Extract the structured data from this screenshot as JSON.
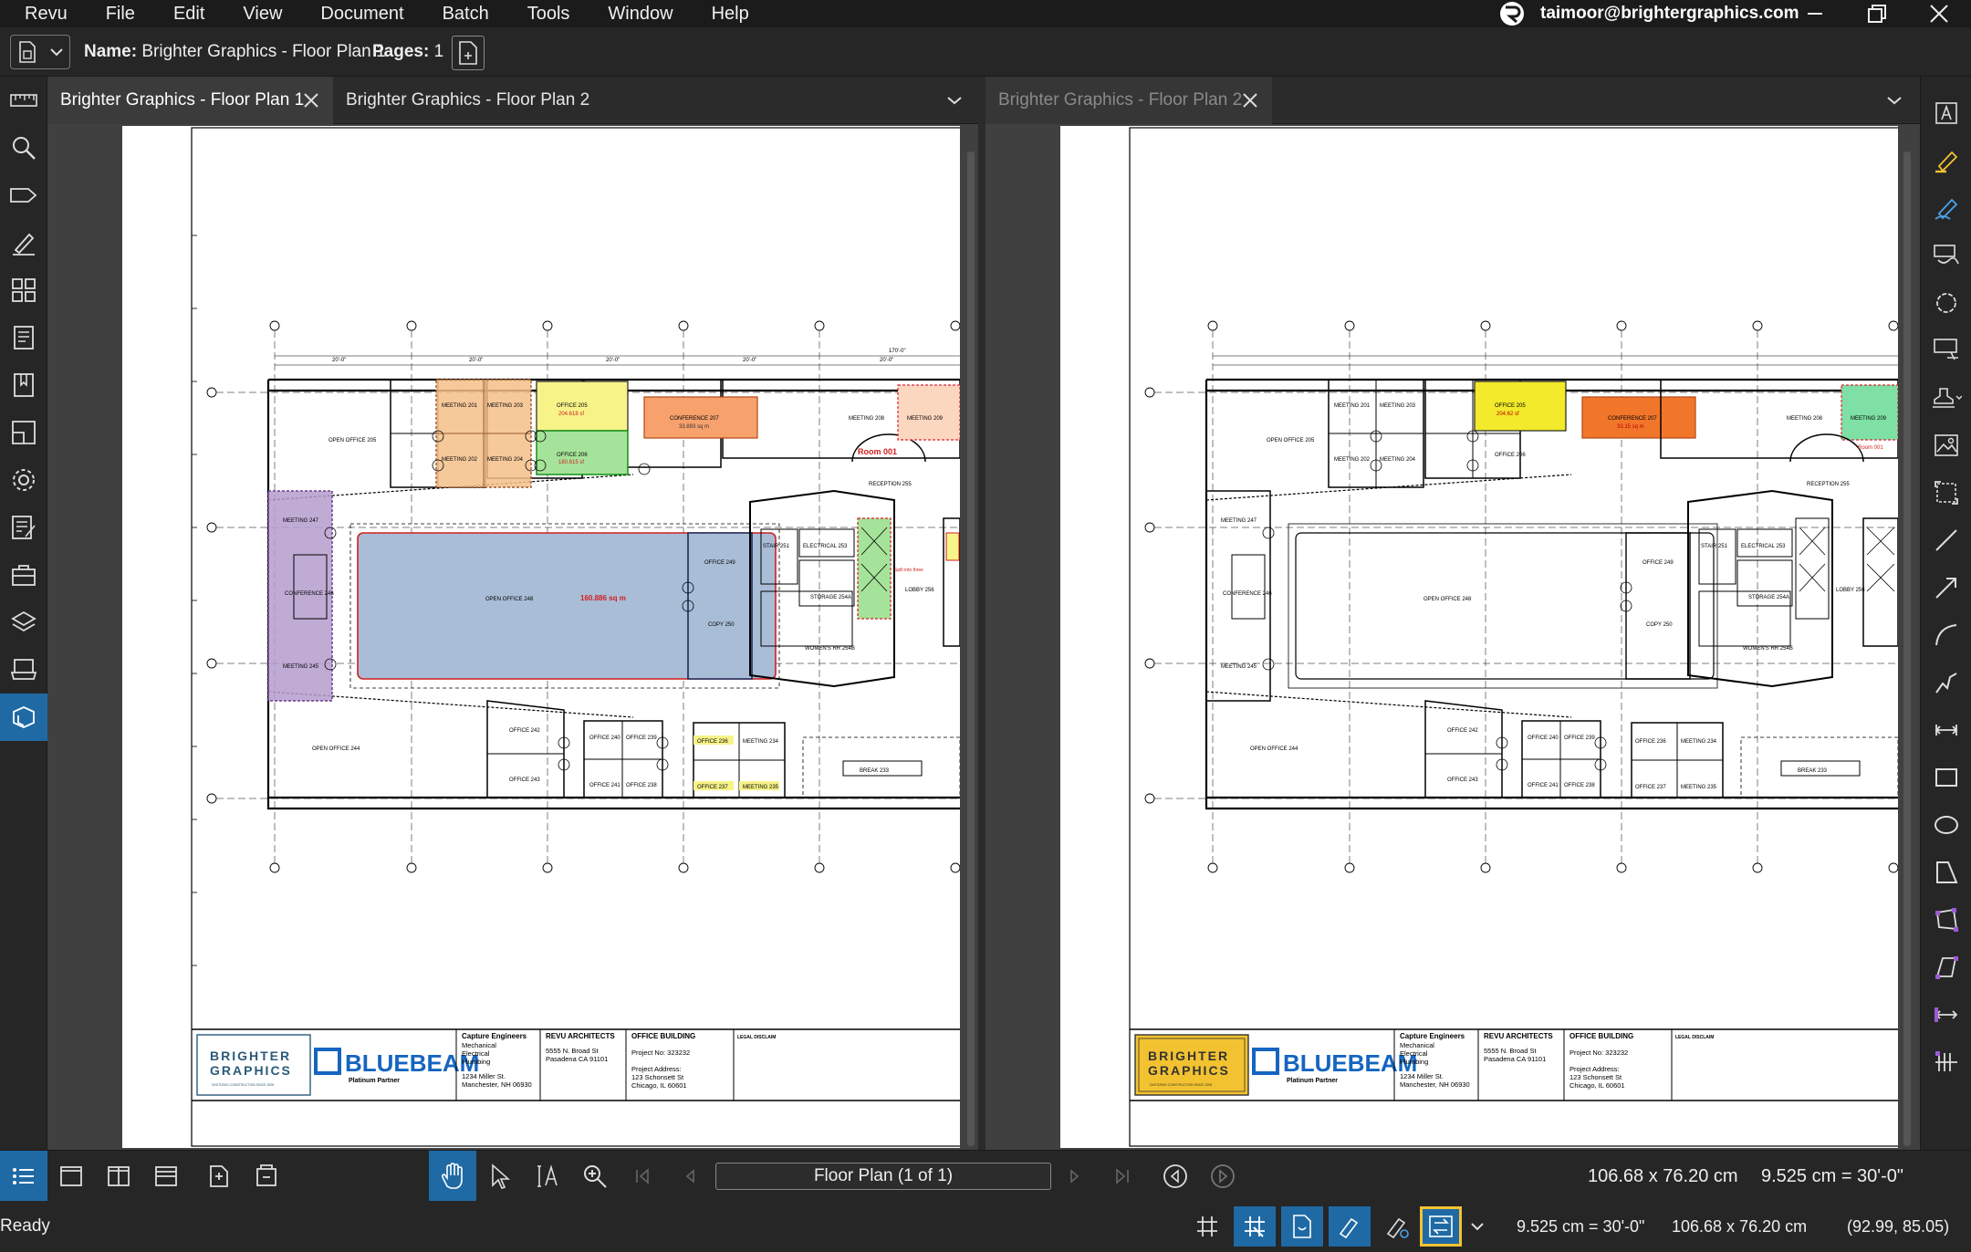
{
  "menu": [
    "Revu",
    "File",
    "Edit",
    "View",
    "Document",
    "Batch",
    "Tools",
    "Window",
    "Help"
  ],
  "user": {
    "email": "taimoor@brightergraphics.com"
  },
  "properties": {
    "name_label": "Name:",
    "name_value": "Brighter Graphics - Floor Plan 1",
    "pages_label": "Pages:",
    "pages_value": "1"
  },
  "left_tabs": [
    {
      "label": "Brighter Graphics - Floor Plan 1",
      "active": true
    },
    {
      "label": "Brighter Graphics - Floor Plan 2",
      "active": false
    }
  ],
  "right_tabs": [
    {
      "label": "Brighter Graphics - Floor Plan 2",
      "active": false
    }
  ],
  "left_toolbar_icons": [
    "measure-icon",
    "search-icon",
    "tag-icon",
    "markup-pen-icon",
    "thumbnails-icon",
    "bookmarks-icon",
    "sets-icon",
    "compare-icon",
    "settings-icon",
    "forms-icon",
    "toolchest-icon",
    "layers-icon",
    "studio-icon",
    "spaces-icon"
  ],
  "right_toolbar_icons": [
    "text-box-icon",
    "highlighter-icon",
    "pen-icon",
    "callout-icon",
    "cloud-icon",
    "note-icon",
    "stamp-icon",
    "image-icon",
    "snapshot-icon",
    "line-icon",
    "arrow-icon",
    "arc-icon",
    "polyline-icon",
    "dimension-icon",
    "rectangle-icon",
    "ellipse-icon",
    "polygon-icon",
    "area-measure-icon",
    "volume-icon",
    "length-measure-icon",
    "count-measure-icon"
  ],
  "floorplan": {
    "rooms": {
      "open_office_205": "OPEN OFFICE 205",
      "meeting_201": "MEETING 201",
      "meeting_203": "MEETING 203",
      "meeting_202": "MEETING 202",
      "meeting_204": "MEETING 204",
      "office_205": "OFFICE 205",
      "office_206": "OFFICE 206",
      "conference_207": "CONFERENCE 207",
      "meeting_208": "MEETING 208",
      "meeting_209": "MEETING 209",
      "reception": "RECEPTION 255",
      "meeting_247": "MEETING 247",
      "conference_246": "CONFERENCE 246",
      "meeting_245": "MEETING 245",
      "open_office_248": "OPEN OFFICE 248",
      "office_249": "OFFICE 249",
      "copy_250": "COPY 250",
      "stair": "STAIR 251",
      "electrical": "ELECTRICAL 253",
      "storage": "STORAGE 254A",
      "womens_rr": "WOMEN'S RR 254B",
      "lobby": "LOBBY 256",
      "open_office_244": "OPEN OFFICE 244",
      "office_242": "OFFICE 242",
      "office_243": "OFFICE 243",
      "office_240": "OFFICE 240",
      "office_239": "OFFICE 239",
      "office_241": "OFFICE 241",
      "office_238": "OFFICE 238",
      "office_236": "OFFICE 236",
      "meeting_234": "MEETING 234",
      "office_237": "OFFICE 237",
      "meeting_235": "MEETING 235",
      "break_233": "BREAK 233"
    },
    "markups": {
      "office_205_area": "204.618 sf",
      "office_206_area": "180.615 sf",
      "conference_area": "33.893 sq m",
      "room_001": "Room 001",
      "open_office_area": "160.886 sq m",
      "split_note": "Split into three",
      "right_office_205_area": "204.62 sf",
      "right_conference_area": "33.15 sq m",
      "right_room_001": "Room 001"
    },
    "titleblock": {
      "brighter_line1": "BRIGHTER",
      "brighter_line2": "GRAPHICS",
      "brighter_tagline": "DIGITIZING CONSTRUCTION SINCE 2005",
      "bluebeam": "BLUEBEAM",
      "bluebeam_sub": "Platinum Partner",
      "engineers_title": "Capture Engineers",
      "engineers_lines": [
        "Mechanical",
        "Electrical",
        "Plumbing"
      ],
      "engineers_addr1": "1234 Miller St.",
      "engineers_addr2": "Manchester, NH 06930",
      "architects_title": "REVU ARCHITECTS",
      "architects_addr1": "5555 N. Broad St",
      "architects_addr2": "Pasadena CA 91101",
      "building_title": "OFFICE BUILDING",
      "project_no": "Project No: 323232",
      "project_address_label": "Project Address:",
      "project_addr1": "123 Schonsett St",
      "project_addr2": "Chicago, IL 60601",
      "legal_title": "LEGAL DISCLAIM"
    }
  },
  "navigation": {
    "page_field": "Floor Plan (1 of 1)",
    "page_size": "106.68 x 76.20 cm",
    "scale": "9.525 cm = 30'-0\""
  },
  "status": {
    "text": "Ready",
    "scale": "9.525 cm = 30'-0\"",
    "page_size": "106.68 x 76.20 cm",
    "coords": "(92.99, 85.05)"
  },
  "colors": {
    "accent_blue": "#1f6aa5",
    "highlight_yellow": "#f2c230",
    "markup_purple": "#b59ccc",
    "markup_orange": "#f4c08a",
    "markup_blue": "#a9bdd7",
    "markup_green": "#a6e39a",
    "markup_yellow": "#f7f389",
    "markup_salmon": "#f7a16c"
  }
}
